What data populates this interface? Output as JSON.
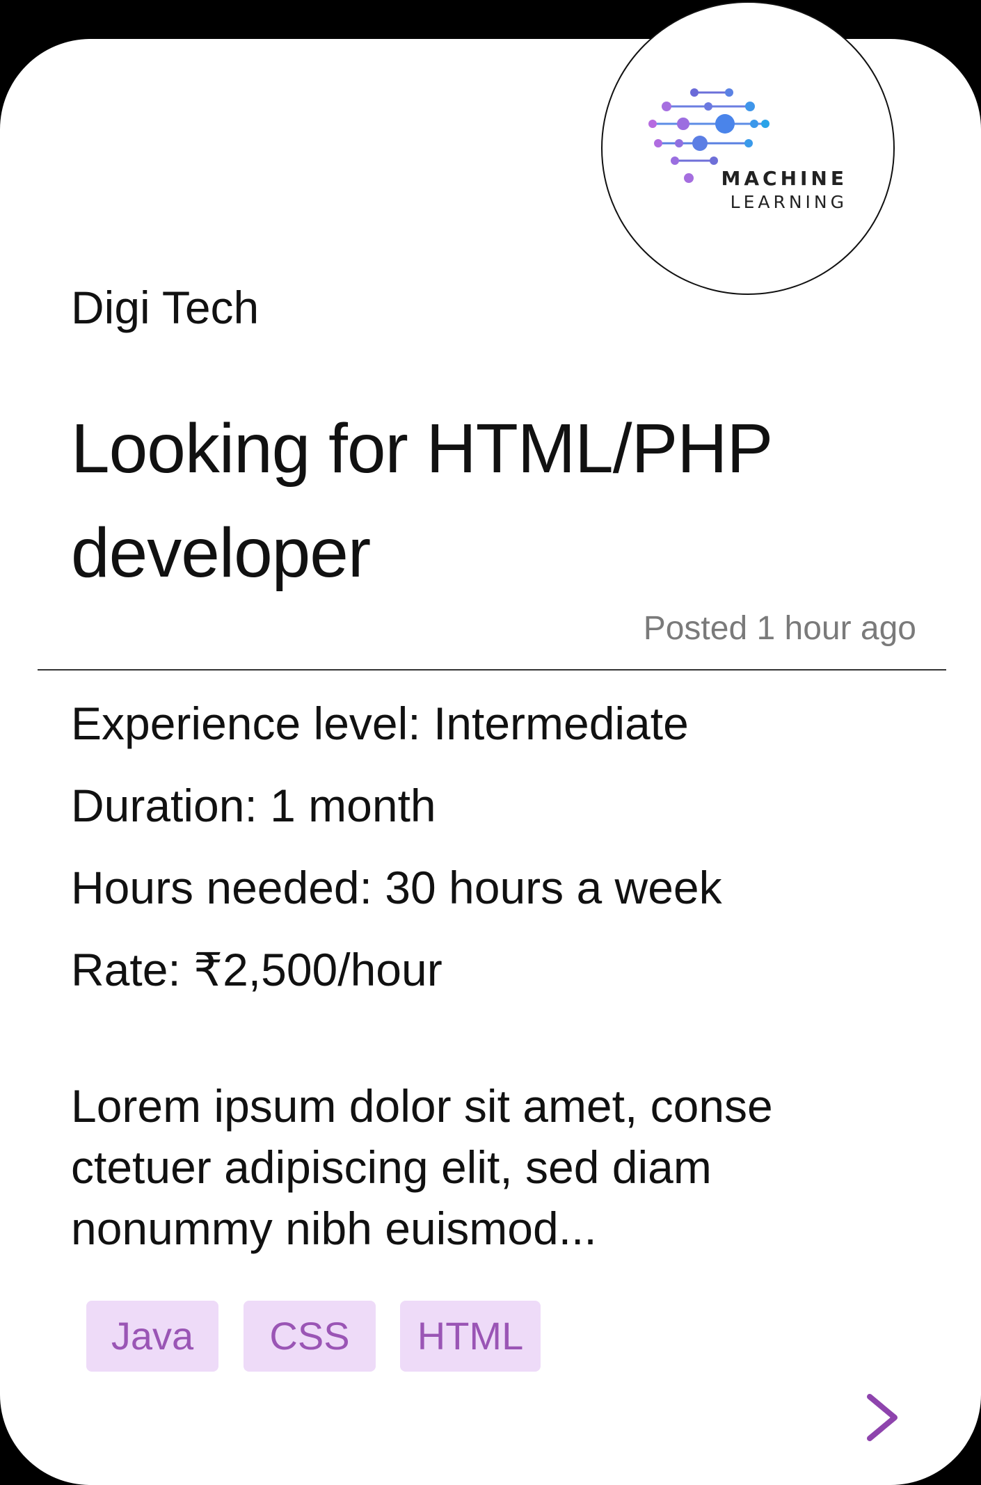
{
  "logo": {
    "line1": "MACHINE",
    "line2": "LEARNING"
  },
  "job": {
    "company": "Digi Tech",
    "title": "Looking for HTML/PHP developer",
    "posted": "Posted 1 hour ago",
    "experience": "Experience level: Intermediate",
    "duration": "Duration: 1 month",
    "hours": "Hours needed: 30 hours a week",
    "rate": "Rate: ₹2,500/hour",
    "description": "Lorem ipsum dolor sit amet, conse ctetuer adipiscing elit, sed diam nonummy nibh euismod..."
  },
  "tags": [
    "Java",
    "CSS",
    "HTML"
  ],
  "colors": {
    "accent": "#8e44ad",
    "tag_bg": "#eedbf8",
    "tag_text": "#9a55b5",
    "muted": "#7a7a7a"
  },
  "icons": {
    "next": "chevron-right-icon",
    "logo": "machine-learning-logo"
  }
}
